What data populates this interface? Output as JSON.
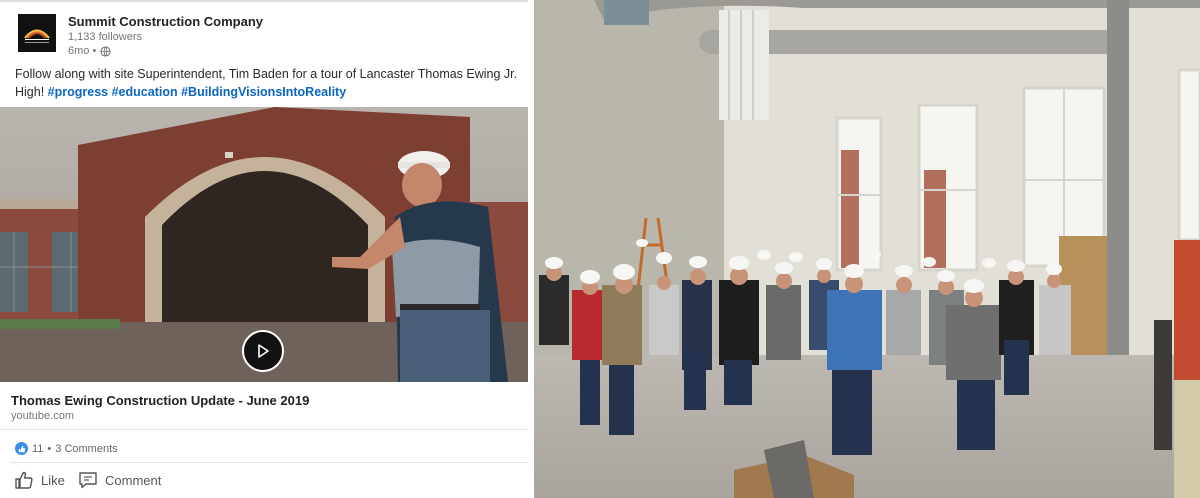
{
  "post": {
    "company_name": "Summit Construction Company",
    "logo_text": "Summit Construction",
    "followers": "1,133 followers",
    "time_ago": "6mo •",
    "body_text": "Follow along with site Superintendent, Tim Baden for a tour of Lancaster Thomas Ewing Jr. High!",
    "hashtags": [
      "#progress",
      "#education",
      "#BuildingVisionsIntoReality"
    ]
  },
  "link_preview": {
    "title": "Thomas Ewing Construction Update - June 2019",
    "domain": "youtube.com"
  },
  "social": {
    "reaction_count": "11",
    "separator": "•",
    "comments": "3 Comments"
  },
  "actions": {
    "like": "Like",
    "comment": "Comment"
  },
  "icons": {
    "globe": "globe-icon",
    "play": "play-icon",
    "like": "thumbs-up-icon",
    "comment": "comment-icon"
  },
  "colors": {
    "hashtag": "#0a66c2",
    "like_badge": "#378fe9"
  }
}
